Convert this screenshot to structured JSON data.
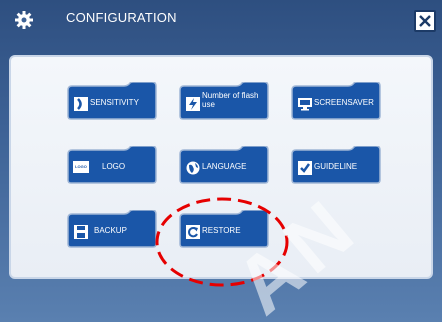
{
  "window": {
    "title": "CONFIGURATION",
    "settings_icon": "gear-icon",
    "close_icon": "close-icon"
  },
  "colors": {
    "window_bg": "#3d6296",
    "button_bg": "#1a56a8",
    "button_border": "#9fb6d6",
    "panel_bg": "#eef2f7",
    "highlight": "#e60000"
  },
  "buttons": [
    {
      "label": "SENSITIVITY",
      "icon": "sensitivity-icon"
    },
    {
      "label": "Number of flash use",
      "icon": "flash-icon"
    },
    {
      "label": "SCREENSAVER",
      "icon": "monitor-icon"
    },
    {
      "label": "LOGO",
      "icon": "logo-icon",
      "icon_text": "LOGO"
    },
    {
      "label": "LANGUAGE",
      "icon": "globe-icon"
    },
    {
      "label": "GUIDELINE",
      "icon": "checkbox-icon"
    },
    {
      "label": "BACKUP",
      "icon": "floppy-disk-icon"
    },
    {
      "label": "RESTORE",
      "icon": "restore-icon"
    }
  ],
  "watermark": {
    "text": "AN"
  }
}
